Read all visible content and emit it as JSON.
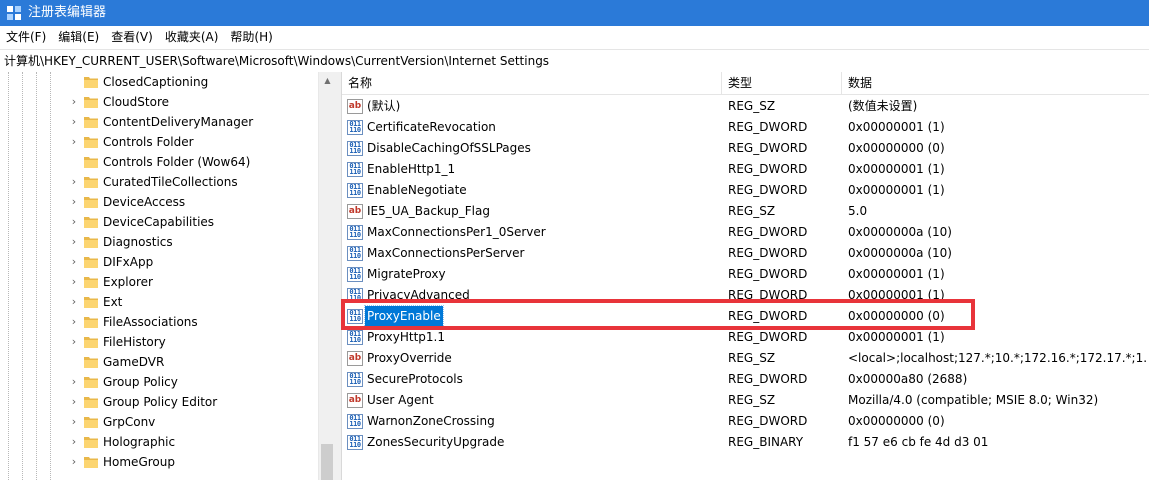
{
  "window": {
    "title": "注册表编辑器",
    "accent": "#2b7ad8",
    "highlight_color": "#e8343a",
    "selection_color": "#0078d7"
  },
  "menu": [
    "文件(F)",
    "编辑(E)",
    "查看(V)",
    "收藏夹(A)",
    "帮助(H)"
  ],
  "address": {
    "path": "计算机\\HKEY_CURRENT_USER\\Software\\Microsoft\\Windows\\CurrentVersion\\Internet Settings"
  },
  "tree": {
    "items": [
      {
        "label": "ClosedCaptioning",
        "expandable": false
      },
      {
        "label": "CloudStore",
        "expandable": true
      },
      {
        "label": "ContentDeliveryManager",
        "expandable": true
      },
      {
        "label": "Controls Folder",
        "expandable": true
      },
      {
        "label": "Controls Folder (Wow64)",
        "expandable": false
      },
      {
        "label": "CuratedTileCollections",
        "expandable": true
      },
      {
        "label": "DeviceAccess",
        "expandable": true
      },
      {
        "label": "DeviceCapabilities",
        "expandable": true
      },
      {
        "label": "Diagnostics",
        "expandable": true
      },
      {
        "label": "DIFxApp",
        "expandable": true
      },
      {
        "label": "Explorer",
        "expandable": true
      },
      {
        "label": "Ext",
        "expandable": true
      },
      {
        "label": "FileAssociations",
        "expandable": true
      },
      {
        "label": "FileHistory",
        "expandable": true
      },
      {
        "label": "GameDVR",
        "expandable": false
      },
      {
        "label": "Group Policy",
        "expandable": true
      },
      {
        "label": "Group Policy Editor",
        "expandable": true
      },
      {
        "label": "GrpConv",
        "expandable": true
      },
      {
        "label": "Holographic",
        "expandable": true
      },
      {
        "label": "HomeGroup",
        "expandable": true
      }
    ]
  },
  "list": {
    "columns": {
      "name": "名称",
      "type": "类型",
      "data": "数据"
    },
    "rows": [
      {
        "name": "(默认)",
        "type": "REG_SZ",
        "data": "(数值未设置)",
        "icon": "string-value-icon"
      },
      {
        "name": "CertificateRevocation",
        "type": "REG_DWORD",
        "data": "0x00000001 (1)",
        "icon": "binary-value-icon"
      },
      {
        "name": "DisableCachingOfSSLPages",
        "type": "REG_DWORD",
        "data": "0x00000000 (0)",
        "icon": "binary-value-icon"
      },
      {
        "name": "EnableHttp1_1",
        "type": "REG_DWORD",
        "data": "0x00000001 (1)",
        "icon": "binary-value-icon"
      },
      {
        "name": "EnableNegotiate",
        "type": "REG_DWORD",
        "data": "0x00000001 (1)",
        "icon": "binary-value-icon"
      },
      {
        "name": "IE5_UA_Backup_Flag",
        "type": "REG_SZ",
        "data": "5.0",
        "icon": "string-value-icon"
      },
      {
        "name": "MaxConnectionsPer1_0Server",
        "type": "REG_DWORD",
        "data": "0x0000000a (10)",
        "icon": "binary-value-icon"
      },
      {
        "name": "MaxConnectionsPerServer",
        "type": "REG_DWORD",
        "data": "0x0000000a (10)",
        "icon": "binary-value-icon"
      },
      {
        "name": "MigrateProxy",
        "type": "REG_DWORD",
        "data": "0x00000001 (1)",
        "icon": "binary-value-icon"
      },
      {
        "name": "PrivacyAdvanced",
        "type": "REG_DWORD",
        "data": "0x00000001 (1)",
        "icon": "binary-value-icon"
      },
      {
        "name": "ProxyEnable",
        "type": "REG_DWORD",
        "data": "0x00000000 (0)",
        "icon": "binary-value-icon",
        "selected": true
      },
      {
        "name": "ProxyHttp1.1",
        "type": "REG_DWORD",
        "data": "0x00000001 (1)",
        "icon": "binary-value-icon"
      },
      {
        "name": "ProxyOverride",
        "type": "REG_SZ",
        "data": "<local>;localhost;127.*;10.*;172.16.*;172.17.*;1...",
        "icon": "string-value-icon"
      },
      {
        "name": "SecureProtocols",
        "type": "REG_DWORD",
        "data": "0x00000a80 (2688)",
        "icon": "binary-value-icon"
      },
      {
        "name": "User Agent",
        "type": "REG_SZ",
        "data": "Mozilla/4.0 (compatible; MSIE 8.0; Win32)",
        "icon": "string-value-icon"
      },
      {
        "name": "WarnonZoneCrossing",
        "type": "REG_DWORD",
        "data": "0x00000000 (0)",
        "icon": "binary-value-icon"
      },
      {
        "name": "ZonesSecurityUpgrade",
        "type": "REG_BINARY",
        "data": "f1 57 e6 cb fe 4d d3 01",
        "icon": "binary-value-icon"
      }
    ]
  }
}
